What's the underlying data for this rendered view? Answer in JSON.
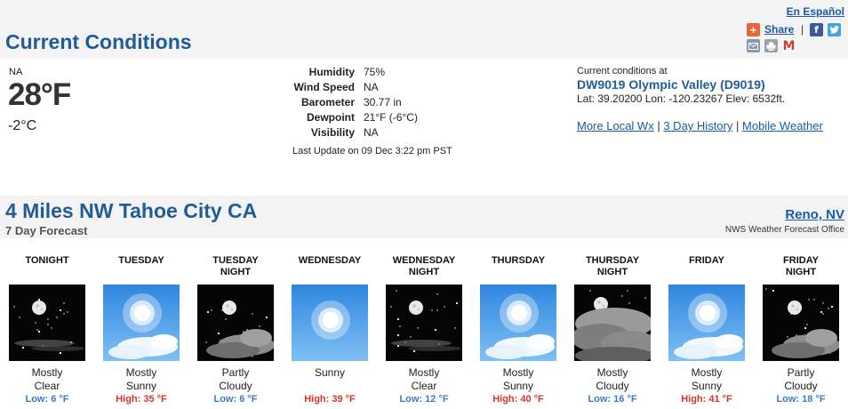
{
  "header": {
    "language_link": "En Español",
    "title": "Current Conditions",
    "share_label": "Share",
    "share_separator": "|"
  },
  "current": {
    "condition": "NA",
    "temp_f": "28°F",
    "temp_c": "-2°C",
    "details": [
      {
        "label": "Humidity",
        "value": "75%"
      },
      {
        "label": "Wind Speed",
        "value": "NA"
      },
      {
        "label": "Barometer",
        "value": "30.77 in"
      },
      {
        "label": "Dewpoint",
        "value": "21°F (-6°C)"
      },
      {
        "label": "Visibility",
        "value": "NA"
      }
    ],
    "last_update": "Last Update on 09 Dec 3:22 pm PST",
    "location_header": "Current conditions at",
    "station": "DW9019 Olympic Valley (D9019)",
    "latlon": "Lat: 39.20200 Lon: -120.23267 Elev: 6532ft.",
    "links": {
      "local_wx": "More Local Wx",
      "history": "3 Day History",
      "mobile": "Mobile Weather",
      "sep": "|"
    }
  },
  "forecast": {
    "title": "4 Miles NW Tahoe City CA",
    "subtitle": "7 Day Forecast",
    "office_link": "Reno, NV",
    "office_label": "NWS Weather Forecast Office",
    "periods": [
      {
        "name1": "TONIGHT",
        "name2": "",
        "icon": "night-clear-icon",
        "desc1": "Mostly",
        "desc2": "Clear",
        "temp": "Low: 6 °F",
        "kind": "low"
      },
      {
        "name1": "TUESDAY",
        "name2": "",
        "icon": "day-mostly-sunny-icon",
        "desc1": "Mostly",
        "desc2": "Sunny",
        "temp": "High: 35 °F",
        "kind": "high"
      },
      {
        "name1": "TUESDAY",
        "name2": "NIGHT",
        "icon": "night-partly-cloudy-icon",
        "desc1": "Partly",
        "desc2": "Cloudy",
        "temp": "Low: 6 °F",
        "kind": "low"
      },
      {
        "name1": "WEDNESDAY",
        "name2": "",
        "icon": "day-sunny-icon",
        "desc1": "Sunny",
        "desc2": "",
        "temp": "High: 39 °F",
        "kind": "high"
      },
      {
        "name1": "WEDNESDAY",
        "name2": "NIGHT",
        "icon": "night-clear-icon",
        "desc1": "Mostly",
        "desc2": "Clear",
        "temp": "Low: 12 °F",
        "kind": "low"
      },
      {
        "name1": "THURSDAY",
        "name2": "",
        "icon": "day-mostly-sunny-icon",
        "desc1": "Mostly",
        "desc2": "Sunny",
        "temp": "High: 40 °F",
        "kind": "high"
      },
      {
        "name1": "THURSDAY",
        "name2": "NIGHT",
        "icon": "night-mostly-cloudy-icon",
        "desc1": "Mostly",
        "desc2": "Cloudy",
        "temp": "Low: 16 °F",
        "kind": "low"
      },
      {
        "name1": "FRIDAY",
        "name2": "",
        "icon": "day-mostly-sunny-icon",
        "desc1": "Mostly",
        "desc2": "Sunny",
        "temp": "High: 41 °F",
        "kind": "high"
      },
      {
        "name1": "FRIDAY",
        "name2": "NIGHT",
        "icon": "night-partly-cloudy-icon",
        "desc1": "Partly",
        "desc2": "Cloudy",
        "temp": "Low: 18 °F",
        "kind": "low"
      }
    ]
  },
  "colors": {
    "title_blue": "#1f5c99",
    "link_blue": "#1a5aa8",
    "low_temp": "#3a7bc8",
    "high_temp": "#d8352a",
    "band_gray": "#f3f3f3"
  }
}
